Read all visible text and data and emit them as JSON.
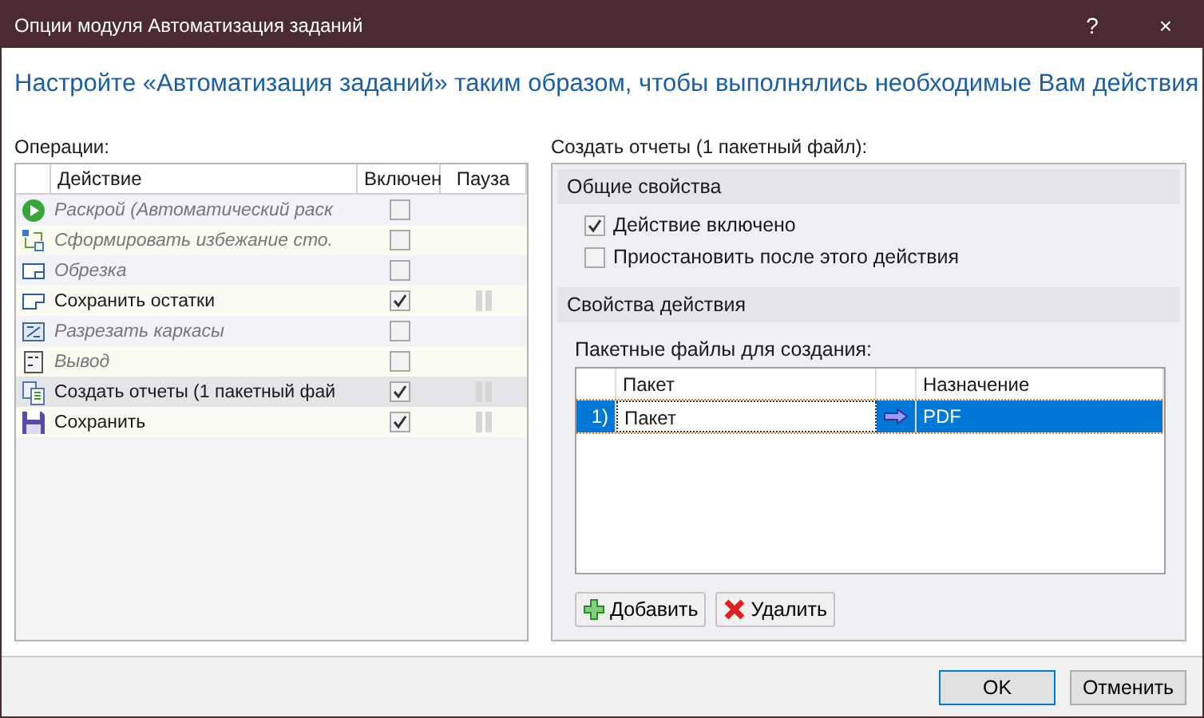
{
  "window": {
    "title": "Опции модуля Автоматизация заданий",
    "help": "?",
    "close": "×"
  },
  "heading": "Настройте «Автоматизация заданий» таким образом, чтобы выполнялись необходимые Вам действия",
  "operations": {
    "label": "Операции:",
    "columns": [
      "Действие",
      "Включен",
      "Пауза"
    ],
    "rows": [
      {
        "kind": "play",
        "label": "Раскрой (Автоматический раск",
        "disabled": true,
        "enabled": false,
        "pause": false,
        "selected": false
      },
      {
        "kind": "shapes",
        "label": "Сформировать избежание сто.",
        "disabled": true,
        "enabled": false,
        "pause": false,
        "selected": false
      },
      {
        "kind": "trim",
        "label": "Обрезка",
        "disabled": true,
        "enabled": false,
        "pause": false,
        "selected": false
      },
      {
        "kind": "remnant",
        "label": "Сохранить остатки",
        "disabled": false,
        "enabled": true,
        "pause": true,
        "selected": false
      },
      {
        "kind": "frames",
        "label": "Разрезать каркасы",
        "disabled": true,
        "enabled": false,
        "pause": false,
        "selected": false
      },
      {
        "kind": "output",
        "label": "Вывод",
        "disabled": true,
        "enabled": false,
        "pause": false,
        "selected": false
      },
      {
        "kind": "reports",
        "label": "Создать отчеты (1 пакетный фай",
        "disabled": false,
        "enabled": true,
        "pause": true,
        "selected": true
      },
      {
        "kind": "save",
        "label": "Сохранить",
        "disabled": false,
        "enabled": true,
        "pause": true,
        "selected": false
      }
    ]
  },
  "details": {
    "label": "Создать отчеты (1 пакетный файл):",
    "general": {
      "title": "Общие свойства",
      "options": [
        {
          "label": "Действие включено",
          "checked": true
        },
        {
          "label": "Приостановить после этого действия",
          "checked": false
        }
      ]
    },
    "action": {
      "title": "Свойства действия",
      "list_label": "Пакетные файлы для создания:",
      "columns": [
        "Пакет",
        "Назначение"
      ],
      "rows": [
        {
          "index": "1)",
          "package": "Пакет",
          "destination": "PDF",
          "selected": true
        }
      ]
    },
    "buttons": [
      {
        "kind": "add",
        "label": "Добавить"
      },
      {
        "kind": "delete",
        "label": "Удалить"
      }
    ]
  },
  "footer": {
    "buttons": [
      {
        "label": "OK",
        "default": true
      },
      {
        "label": "Отменить",
        "default": false
      }
    ]
  }
}
